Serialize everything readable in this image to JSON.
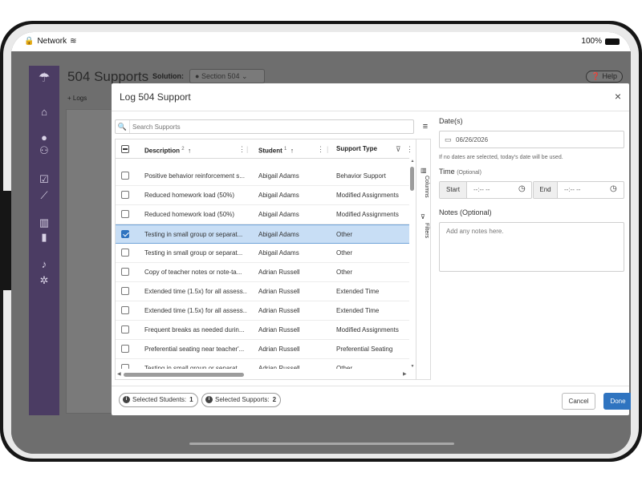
{
  "status_bar": {
    "network": "Network",
    "battery": "100%"
  },
  "app": {
    "title": "504 Supports",
    "solution_label": "Solution:",
    "solution_value": "Section 504",
    "help": "Help",
    "logs": "+ Logs"
  },
  "sidebar": {
    "icons": [
      "umbrella-icon",
      "home-icon",
      "user-icon",
      "users-icon",
      "checkbox-icon",
      "chart-line-icon",
      "chart-bar-icon",
      "file-icon",
      "bell-icon",
      "gear-icon"
    ]
  },
  "modal": {
    "title": "Log 504 Support",
    "close": "×",
    "search_placeholder": "Search Supports",
    "columns": {
      "description": "Description",
      "description_sort": "2",
      "student": "Student",
      "student_sort": "1",
      "support_type": "Support Type"
    },
    "side_tools": {
      "columns": "Columns",
      "filters": "Filters"
    },
    "rows": [
      {
        "description": "Positive behavior reinforcement s...",
        "student": "Abigail Adams",
        "type": "Behavior Support",
        "checked": false
      },
      {
        "description": "Reduced homework load (50%)",
        "student": "Abigail Adams",
        "type": "Modified Assignments",
        "checked": false
      },
      {
        "description": "Reduced homework load (50%)",
        "student": "Abigail Adams",
        "type": "Modified Assignments",
        "checked": false
      },
      {
        "description": "Testing in small group or separat...",
        "student": "Abigail Adams",
        "type": "Other",
        "checked": true
      },
      {
        "description": "Testing in small group or separat...",
        "student": "Abigail Adams",
        "type": "Other",
        "checked": false
      },
      {
        "description": "Copy of teacher notes or note-ta...",
        "student": "Adrian Russell",
        "type": "Other",
        "checked": false
      },
      {
        "description": "Extended time (1.5x) for all assess...",
        "student": "Adrian Russell",
        "type": "Extended Time",
        "checked": false
      },
      {
        "description": "Extended time (1.5x) for all assess...",
        "student": "Adrian Russell",
        "type": "Extended Time",
        "checked": false
      },
      {
        "description": "Frequent breaks as needed durin...",
        "student": "Adrian Russell",
        "type": "Modified Assignments",
        "checked": false
      },
      {
        "description": "Preferential seating near teacher'...",
        "student": "Adrian Russell",
        "type": "Preferential Seating",
        "checked": false
      },
      {
        "description": "Testing in small group or separat...",
        "student": "Adrian Russell",
        "type": "Other",
        "checked": false
      }
    ],
    "dates_label": "Date(s)",
    "date_value": "06/26/2026",
    "date_hint": "If no dates are selected, today's date will be used.",
    "time_label": "Time",
    "time_optional": "(Optional)",
    "start_label": "Start",
    "end_label": "End",
    "time_placeholder": "--:-- --",
    "notes_label": "Notes (Optional)",
    "notes_placeholder": "Add any notes here.",
    "footer": {
      "selected_students_label": "Selected Students:",
      "selected_students_count": "1",
      "selected_supports_label": "Selected Supports:",
      "selected_supports_count": "2",
      "cancel": "Cancel",
      "done": "Done"
    }
  }
}
